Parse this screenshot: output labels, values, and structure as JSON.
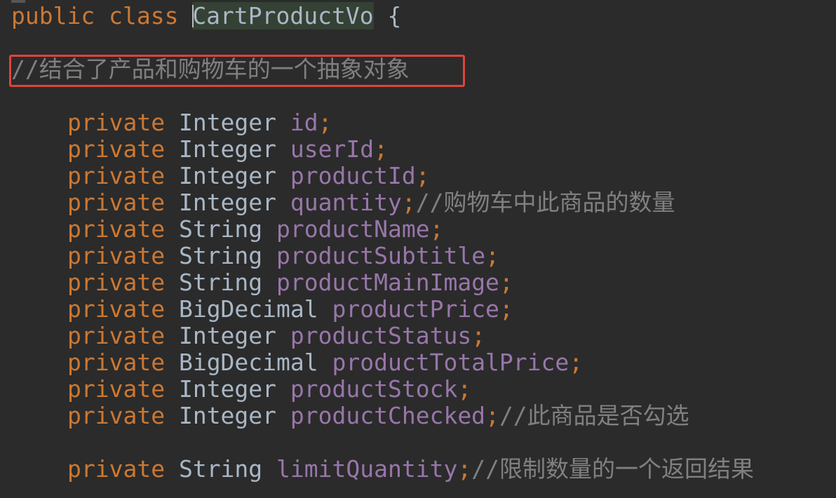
{
  "code": {
    "class_decl": {
      "public": "public",
      "class": "class",
      "name": "CartProductVo",
      "brace": "{"
    },
    "class_comment": "//结合了产品和购物车的一个抽象对象",
    "fields": [
      {
        "modifier": "private",
        "type": "Integer",
        "name": "id",
        "semi": ";",
        "comment": ""
      },
      {
        "modifier": "private",
        "type": "Integer",
        "name": "userId",
        "semi": ";",
        "comment": ""
      },
      {
        "modifier": "private",
        "type": "Integer",
        "name": "productId",
        "semi": ";",
        "comment": ""
      },
      {
        "modifier": "private",
        "type": "Integer",
        "name": "quantity",
        "semi": ";",
        "comment": "//购物车中此商品的数量"
      },
      {
        "modifier": "private",
        "type": "String",
        "name": "productName",
        "semi": ";",
        "comment": ""
      },
      {
        "modifier": "private",
        "type": "String",
        "name": "productSubtitle",
        "semi": ";",
        "comment": ""
      },
      {
        "modifier": "private",
        "type": "String",
        "name": "productMainImage",
        "semi": ";",
        "comment": ""
      },
      {
        "modifier": "private",
        "type": "BigDecimal",
        "name": "productPrice",
        "semi": ";",
        "comment": ""
      },
      {
        "modifier": "private",
        "type": "Integer",
        "name": "productStatus",
        "semi": ";",
        "comment": ""
      },
      {
        "modifier": "private",
        "type": "BigDecimal",
        "name": "productTotalPrice",
        "semi": ";",
        "comment": ""
      },
      {
        "modifier": "private",
        "type": "Integer",
        "name": "productStock",
        "semi": ";",
        "comment": ""
      },
      {
        "modifier": "private",
        "type": "Integer",
        "name": "productChecked",
        "semi": ";",
        "comment": "//此商品是否勾选"
      },
      {
        "modifier": "private",
        "type": "String",
        "name": "limitQuantity",
        "semi": ";",
        "comment": "//限制数量的一个返回结果"
      }
    ]
  },
  "colors": {
    "background": "#2b2b2b",
    "keyword": "#cc7832",
    "type": "#a9b7c6",
    "field": "#9876aa",
    "comment": "#808080",
    "highlight_border": "#e0433b"
  }
}
